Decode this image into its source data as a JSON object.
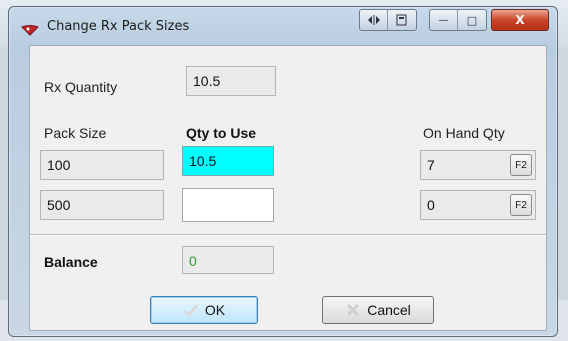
{
  "window": {
    "title": "Change Rx Pack Sizes",
    "minimize_glyph": "—",
    "maximize_glyph": "□",
    "close_glyph": "X"
  },
  "rx_quantity": {
    "label": "Rx Quantity",
    "value": "10.5"
  },
  "columns": {
    "pack_size": "Pack Size",
    "qty_to_use": "Qty to Use",
    "on_hand_qty": "On Hand Qty"
  },
  "rows": [
    {
      "pack_size": "100",
      "qty_to_use": "10.5",
      "on_hand": "7",
      "f2_label": "F2"
    },
    {
      "pack_size": "500",
      "qty_to_use": "",
      "on_hand": "0",
      "f2_label": "F2"
    }
  ],
  "balance": {
    "label": "Balance",
    "value": "0"
  },
  "buttons": {
    "ok": "OK",
    "cancel": "Cancel"
  },
  "colors": {
    "active_field": "#00ffff",
    "balance_text": "#2a9a2a",
    "close_button": "#c9452b"
  },
  "icons": {
    "title": "rx-pill-icon",
    "ok": "checkmark-icon",
    "cancel": "x-icon"
  }
}
